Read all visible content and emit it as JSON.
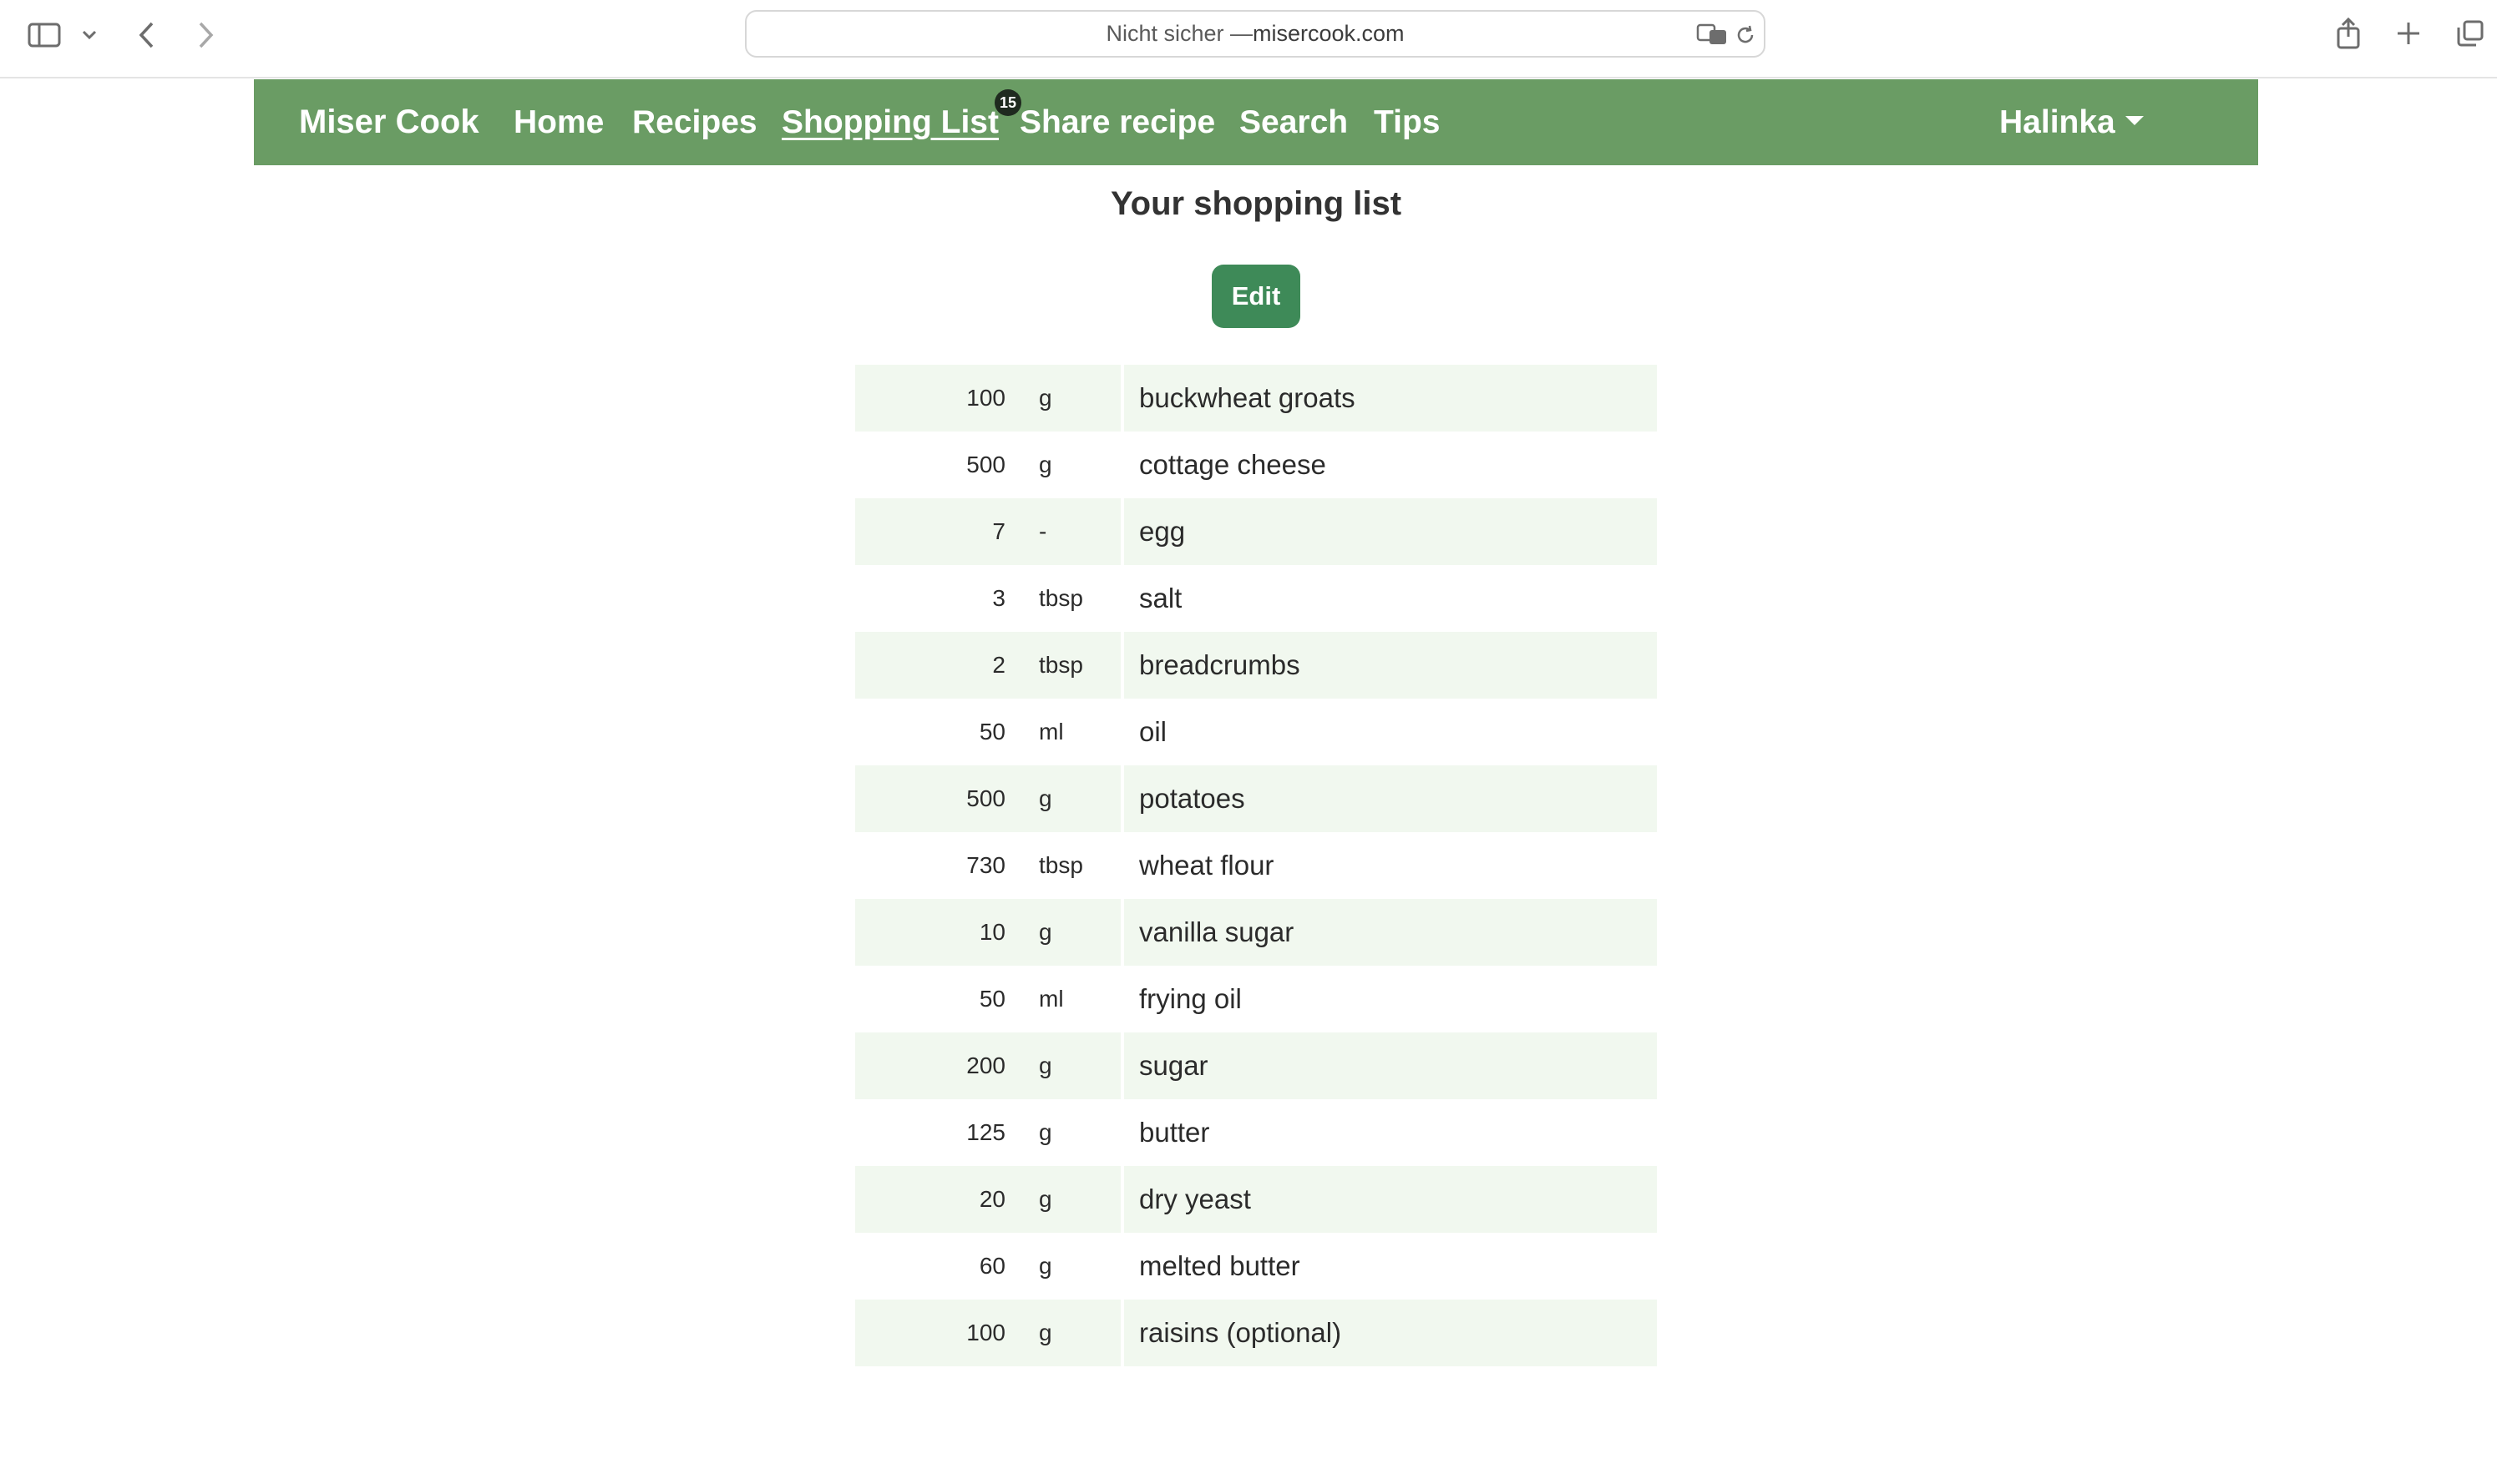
{
  "browser": {
    "address_prefix": "Nicht sicher — ",
    "address_domain": "misercook.com"
  },
  "nav": {
    "brand": "Miser Cook",
    "links": [
      "Home",
      "Recipes",
      "Shopping List",
      "Share recipe",
      "Search",
      "Tips"
    ],
    "active": "Shopping List",
    "shopping_badge": "15",
    "user": "Halinka"
  },
  "page": {
    "title": "Your shopping list",
    "edit_label": "Edit"
  },
  "items": [
    {
      "qty": "100",
      "unit": "g",
      "name": "buckwheat groats"
    },
    {
      "qty": "500",
      "unit": "g",
      "name": "cottage cheese"
    },
    {
      "qty": "7",
      "unit": "-",
      "name": "egg"
    },
    {
      "qty": "3",
      "unit": "tbsp",
      "name": "salt"
    },
    {
      "qty": "2",
      "unit": "tbsp",
      "name": "breadcrumbs"
    },
    {
      "qty": "50",
      "unit": "ml",
      "name": "oil"
    },
    {
      "qty": "500",
      "unit": "g",
      "name": "potatoes"
    },
    {
      "qty": "730",
      "unit": "tbsp",
      "name": "wheat flour"
    },
    {
      "qty": "10",
      "unit": "g",
      "name": "vanilla sugar"
    },
    {
      "qty": "50",
      "unit": "ml",
      "name": "frying oil"
    },
    {
      "qty": "200",
      "unit": "g",
      "name": "sugar"
    },
    {
      "qty": "125",
      "unit": "g",
      "name": "butter"
    },
    {
      "qty": "20",
      "unit": "g",
      "name": "dry yeast"
    },
    {
      "qty": "60",
      "unit": "g",
      "name": "melted butter"
    },
    {
      "qty": "100",
      "unit": "g",
      "name": "raisins (optional)"
    }
  ],
  "colors": {
    "navbar": "#6a9c64",
    "edit_button": "#3e8a58",
    "stripe": "#f1f8ef"
  }
}
